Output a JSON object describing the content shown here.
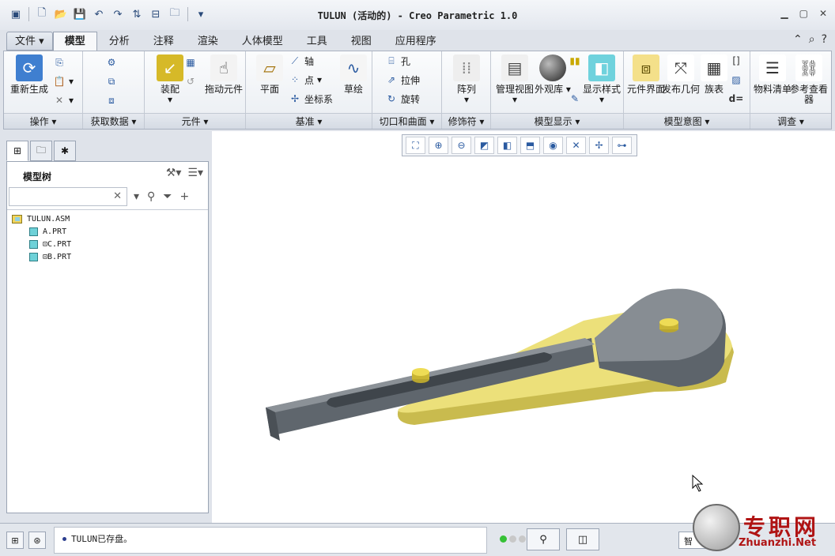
{
  "window": {
    "title": "TULUN (活动的) - Creo Parametric 1.0"
  },
  "tabs": {
    "file": "文件",
    "model": "模型",
    "analysis": "分析",
    "annotate": "注释",
    "render": "渲染",
    "manikin": "人体模型",
    "tools": "工具",
    "view": "视图",
    "applications": "应用程序"
  },
  "ribbon": {
    "groups": {
      "operations": "操作",
      "get_data": "获取数据",
      "component": "元件",
      "datum": "基准",
      "cuts_surfaces": "切口和曲面",
      "modifiers": "修饰符",
      "model_display": "模型显示",
      "model_intent": "模型意图",
      "investigate": "调查"
    },
    "buttons": {
      "regenerate": "重新生成",
      "assemble": "装配",
      "drag_components": "拖动元件",
      "plane": "平面",
      "axis": "轴",
      "point": "点",
      "csys": "坐标系",
      "sketch": "草绘",
      "hole": "孔",
      "extrude": "拉伸",
      "revolve": "旋转",
      "pattern": "阵列",
      "manage_views": "管理视图",
      "appearance_gallery": "外观库",
      "display_style": "显示样式",
      "component_interface": "元件界面",
      "publish_geometry": "发布几何",
      "family_table": "族表",
      "bom": "物料清单",
      "reference_viewer": "参考查看器",
      "relations_symbol": "d="
    }
  },
  "model_tree": {
    "title": "模型树",
    "search_placeholder": "",
    "items": [
      {
        "label": "TULUN.ASM",
        "type": "assembly"
      },
      {
        "label": "A.PRT",
        "type": "part"
      },
      {
        "label": "⊡C.PRT",
        "type": "part"
      },
      {
        "label": "⊡B.PRT",
        "type": "part"
      }
    ]
  },
  "status": {
    "message": "TULUN已存盘。",
    "filter_value": "智"
  },
  "watermark": {
    "cn": "专职网",
    "en": "Zhuanzhi.Net"
  },
  "colors": {
    "part_gray": "#6c737a",
    "part_gray_top": "#8a9096",
    "part_yellow": "#e9dc6e",
    "pin_yellow": "#e6d24a",
    "accent_blue": "#2a5aa0"
  },
  "icons": {
    "regenerate": "regenerate-icon",
    "assemble": "assemble-icon",
    "drag": "hand-icon",
    "plane": "plane-icon",
    "sketch": "sketch-icon",
    "pattern": "pattern-icon",
    "appearance": "sphere-icon",
    "display": "cube-icon"
  }
}
